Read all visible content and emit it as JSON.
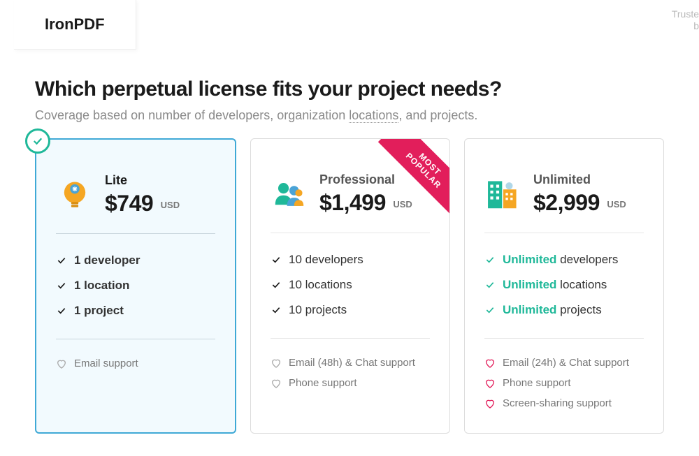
{
  "tab": "IronPDF",
  "trusted_line1": "Truste",
  "trusted_line2": "b",
  "heading": "Which perpetual license fits your project needs?",
  "subtitle_pre": "Coverage based on number of developers, organization ",
  "subtitle_dotted": "locations",
  "subtitle_post": ", and projects.",
  "currency": "USD",
  "tiers": {
    "lite": {
      "name": "Lite",
      "price": "$749",
      "f1": "1 developer",
      "f2": "1 location",
      "f3": "1 project",
      "s1": "Email support"
    },
    "pro": {
      "ribbon1": "MOST",
      "ribbon2": "POPULAR",
      "name": "Professional",
      "price": "$1,499",
      "f1": "10 developers",
      "f2": "10 locations",
      "f3": "10 projects",
      "s1": "Email (48h) & Chat support",
      "s2": "Phone support"
    },
    "unl": {
      "name": "Unlimited",
      "price": "$2,999",
      "f1_strong": "Unlimited",
      "f1_rest": " developers",
      "f2_strong": "Unlimited",
      "f2_rest": " locations",
      "f3_strong": "Unlimited",
      "f3_rest": " projects",
      "s1": "Email (24h) & Chat support",
      "s2": "Phone support",
      "s3": "Screen-sharing support"
    }
  }
}
